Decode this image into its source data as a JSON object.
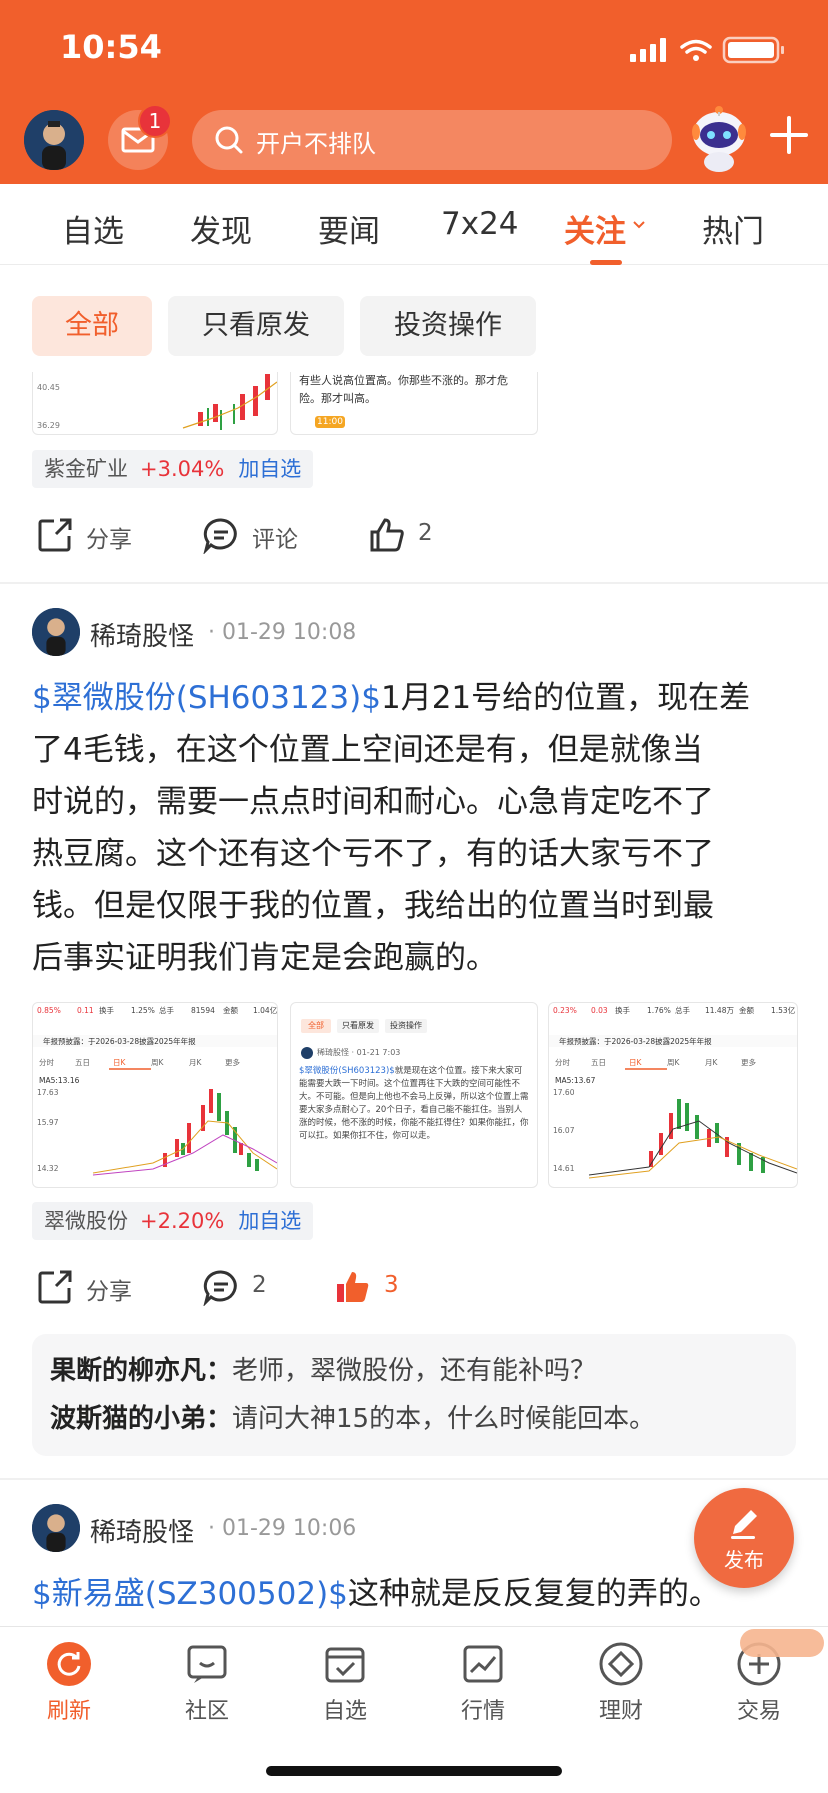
{
  "status": {
    "time": "10:54"
  },
  "header": {
    "mail_badge": "1",
    "search_placeholder": "开户不排队"
  },
  "tabs": [
    {
      "label": "自选"
    },
    {
      "label": "发现"
    },
    {
      "label": "要闻"
    },
    {
      "label": "7x24"
    },
    {
      "label": "关注",
      "active": true
    },
    {
      "label": "热门"
    }
  ],
  "filters": [
    {
      "label": "全部",
      "active": true
    },
    {
      "label": "只看原发"
    },
    {
      "label": "投资操作"
    }
  ],
  "post0": {
    "thumb_text": "有些人说高位置高。你那些不涨的。那才危险。那才叫高。",
    "thumb_time": "11:00",
    "stock": {
      "name": "紫金矿业",
      "change": "+3.04%",
      "add": "加自选"
    },
    "actions": {
      "share": "分享",
      "comment": "评论",
      "likes": "2"
    }
  },
  "post1": {
    "user": "稀琦股怪",
    "time": "· 01-29 10:08",
    "symbol": "$翠微股份(SH603123)$",
    "lines": [
      "1月21号给的位置，现在差",
      "了4毛钱，在这个位置上空间还是有，但是就像当",
      "时说的，需要一点点时间和耐心。心急肯定吃不了",
      "热豆腐。这个还有这个亏不了，有的话大家亏不了",
      "钱。但是仅限于我的位置，我给出的位置当时到最",
      "后事实证明我们肯定是会跑赢的。"
    ],
    "thumb2": {
      "filters": [
        "全部",
        "只看原发",
        "投资操作"
      ],
      "user": "稀琦股怪 · 01-21 7:03",
      "symbol": "$翠微股份(SH603123)$",
      "text": "就是现在这个位置。接下来大家可能需要大跌一下时间。这个位置再往下大跌的空间可能性不大。不可能。但是向上他也不会马上反弹，所以这个位置上需要大家多点耐心了。20个日子，看自己能不能扛住。当别人涨的时候，他不涨的时候，你能不能扛得住？如果你能扛，你可以扛。如果你扛不住，你可以走。"
    },
    "chart_labels": {
      "header1": [
        "0.85%",
        "0.11",
        "换手",
        "1.25%",
        "总手",
        "81594",
        "金额",
        "1.04亿"
      ],
      "header3": [
        "0.23%",
        "0.03",
        "换手",
        "1.76%",
        "总手",
        "11.48万",
        "金额",
        "1.53亿"
      ],
      "notice": "年报预披露：于2026-03-28披露2025年年报",
      "periods": [
        "分时",
        "五日",
        "日K",
        "周K",
        "月K",
        "更多"
      ],
      "ma1": "MA5:13.16",
      "ma3": "MA5:13.67",
      "y1": [
        "17.63",
        "15.97",
        "14.32"
      ],
      "y3": [
        "17.60",
        "16.07",
        "14.61"
      ]
    },
    "stock": {
      "name": "翠微股份",
      "change": "+2.20%",
      "add": "加自选"
    },
    "actions": {
      "share": "分享",
      "comments": "2",
      "likes": "3"
    },
    "comments": [
      {
        "user": "果断的柳亦凡：",
        "text": "老师，翠微股份，还有能补吗？"
      },
      {
        "user": "波斯猫的小弟：",
        "text": "请问大神15的本，什么时候能回本。"
      }
    ]
  },
  "post2": {
    "user": "稀琦股怪",
    "time": "· 01-29 10:06",
    "symbol": "$新易盛(SZ300502)$",
    "text": "这种就是反反复复的弄的。"
  },
  "fab": {
    "label": "发布"
  },
  "bottom_nav": [
    {
      "label": "刷新",
      "active": true
    },
    {
      "label": "社区"
    },
    {
      "label": "自选"
    },
    {
      "label": "行情"
    },
    {
      "label": "理财"
    },
    {
      "label": "交易"
    }
  ],
  "colors": {
    "brand": "#f15f2c",
    "up": "#e8333a",
    "link": "#2d6fd5"
  }
}
